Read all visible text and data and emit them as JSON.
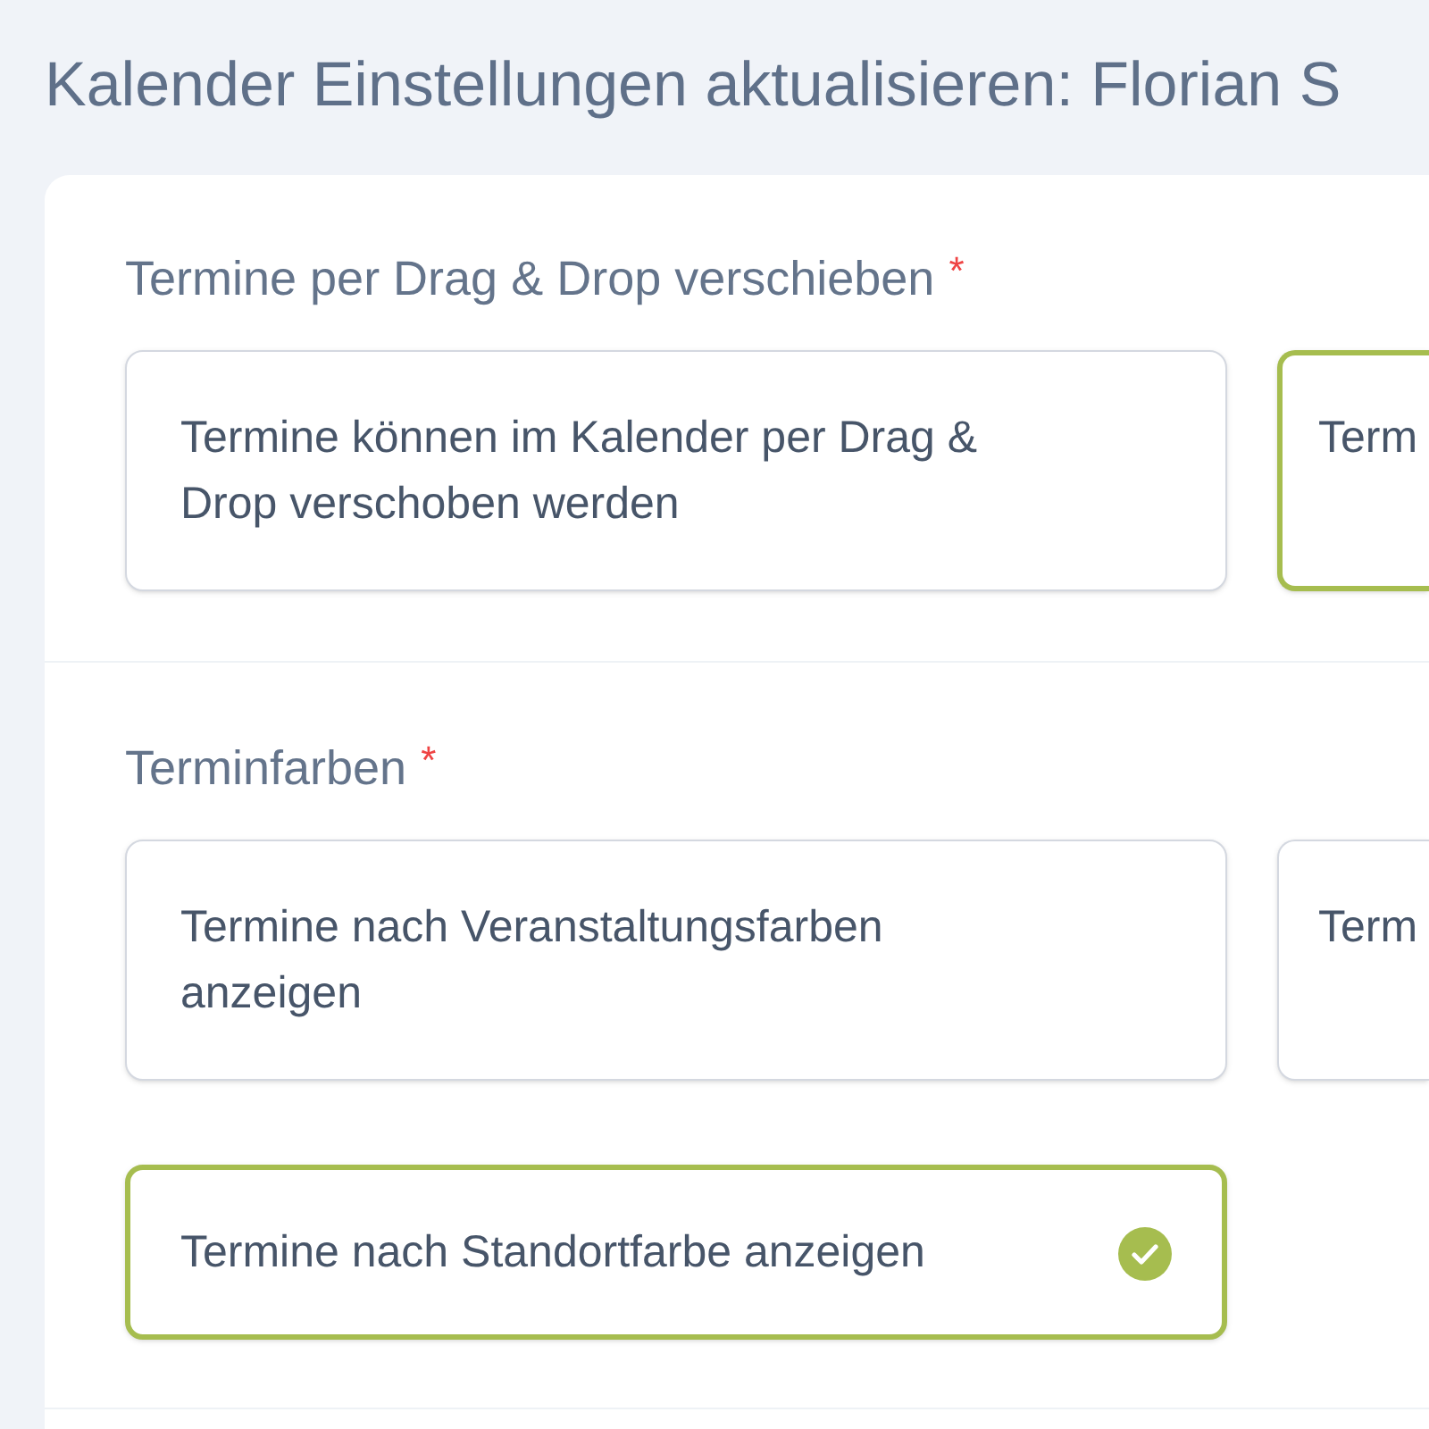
{
  "page": {
    "title": "Kalender Einstellungen aktualisieren: Florian S"
  },
  "sections": [
    {
      "label": "Termine per Drag & Drop verschieben",
      "required_mark": "*",
      "options": [
        {
          "label": "Termine können im Kalender per Drag & Drop verschoben werden",
          "selected": false
        },
        {
          "label": "Term",
          "selected": true
        }
      ]
    },
    {
      "label": "Terminfarben",
      "required_mark": "*",
      "options": [
        {
          "label": "Termine nach Veranstaltungsfarben anzeigen",
          "selected": false
        },
        {
          "label": "Term",
          "selected": false
        },
        {
          "label": "Termine nach Standortfarbe anzeigen",
          "selected": true
        }
      ]
    }
  ]
}
